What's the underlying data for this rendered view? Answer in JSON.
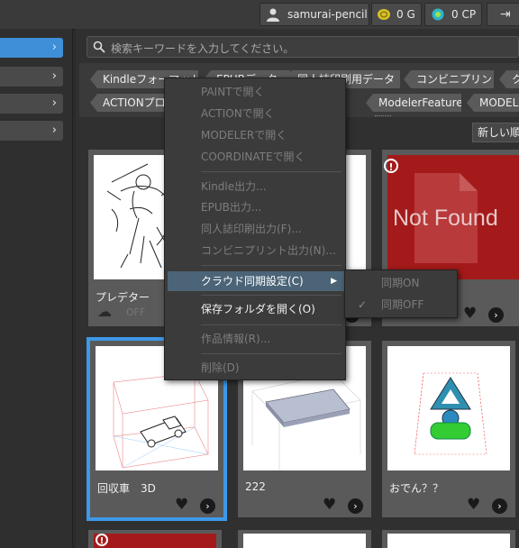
{
  "topbar": {
    "username": "samurai-pencil",
    "gold": "0 G",
    "cp": "0 CP"
  },
  "search": {
    "placeholder": "検索キーワードを入力してください。"
  },
  "tags": [
    "Kindleフォーマット",
    "EPUBデータ",
    "同人誌印刷用データ",
    "コンビニプリント",
    "ク",
    "ACTIONプロジ",
    "ModelerFeature",
    "MODEL"
  ],
  "sort": {
    "label": "新しい順"
  },
  "cards": [
    {
      "title": "プレデター",
      "sync_label": "OFF"
    },
    {
      "title": "Not Found"
    },
    {
      "title": "回収車　3D"
    },
    {
      "title": "222"
    },
    {
      "title": "おでん？？"
    }
  ],
  "menu": {
    "items": [
      {
        "label": "PAINTで開く"
      },
      {
        "label": "ACTIONで開く"
      },
      {
        "label": "MODELERで開く"
      },
      {
        "label": "COORDINATEで開く"
      },
      {
        "label": "Kindle出力..."
      },
      {
        "label": "EPUB出力..."
      },
      {
        "label": "同人誌印刷出力(F)..."
      },
      {
        "label": "コンビニプリント出力(N)..."
      },
      {
        "label": "クラウド同期設定(C)"
      },
      {
        "label": "保存フォルダを開く(O)"
      },
      {
        "label": "作品情報(R)..."
      },
      {
        "label": "削除(D)"
      }
    ]
  },
  "submenu": {
    "items": [
      {
        "label": "同期ON"
      },
      {
        "label": "同期OFF"
      }
    ]
  },
  "colors": {
    "accent": "#3e99e8",
    "error": "#a41a1a",
    "highlight": "#4b6477"
  }
}
